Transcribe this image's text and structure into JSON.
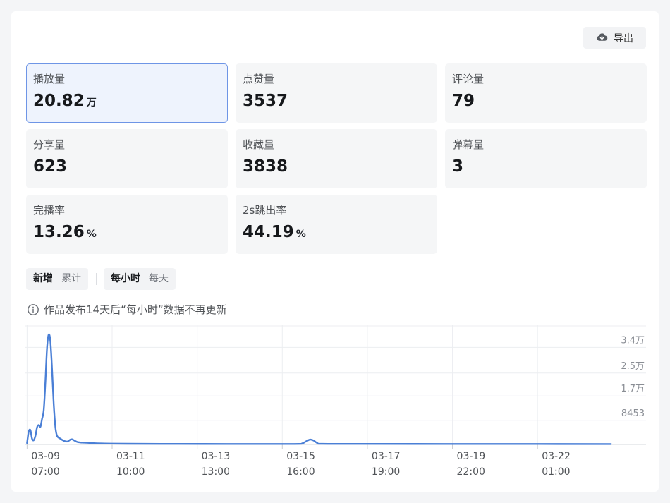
{
  "toolbar": {
    "export_label": "导出",
    "export_icon": "cloud-download-icon"
  },
  "metrics": [
    {
      "label": "播放量",
      "value": "20.82",
      "unit": "万",
      "active": true
    },
    {
      "label": "点赞量",
      "value": "3537",
      "unit": ""
    },
    {
      "label": "评论量",
      "value": "79",
      "unit": ""
    },
    {
      "label": "分享量",
      "value": "623",
      "unit": ""
    },
    {
      "label": "收藏量",
      "value": "3838",
      "unit": ""
    },
    {
      "label": "弹幕量",
      "value": "3",
      "unit": ""
    },
    {
      "label": "完播率",
      "value": "13.26",
      "unit": "%"
    },
    {
      "label": "2s跳出率",
      "value": "44.19",
      "unit": "%"
    }
  ],
  "toggles": {
    "mode": {
      "options": [
        "新增",
        "累计"
      ],
      "selected": "新增"
    },
    "granularity": {
      "options": [
        "每小时",
        "每天"
      ],
      "selected": "每小时"
    }
  },
  "notice": {
    "icon": "info-circle-icon",
    "text": "作品发布14天后“每小时”数据不再更新"
  },
  "colors": {
    "accent": "#4a7fd6",
    "active_border": "#6e95e6",
    "active_bg": "#eef3fd"
  },
  "chart_data": {
    "type": "line",
    "grid": true,
    "ylim": [
      0,
      42000
    ],
    "y_ticks": [
      {
        "value": 8453,
        "label": "8453"
      },
      {
        "value": 17000,
        "label": "1.7万"
      },
      {
        "value": 25000,
        "label": "2.5万"
      },
      {
        "value": 34000,
        "label": "3.4万"
      }
    ],
    "x_ticks": [
      {
        "hour": 0,
        "date": "03-09",
        "time": "07:00"
      },
      {
        "hour": 51,
        "date": "03-11",
        "time": "10:00"
      },
      {
        "hour": 102,
        "date": "03-13",
        "time": "13:00"
      },
      {
        "hour": 153,
        "date": "03-15",
        "time": "16:00"
      },
      {
        "hour": 204,
        "date": "03-17",
        "time": "19:00"
      },
      {
        "hour": 255,
        "date": "03-19",
        "time": "22:00"
      },
      {
        "hour": 306,
        "date": "03-22",
        "time": "01:00"
      }
    ],
    "xlim": [
      -1,
      352
    ],
    "series": [
      {
        "points": [
          [
            0,
            500
          ],
          [
            1,
            4500
          ],
          [
            2,
            5000
          ],
          [
            3,
            2000
          ],
          [
            4,
            1500
          ],
          [
            5,
            3000
          ],
          [
            6,
            6000
          ],
          [
            7,
            6800
          ],
          [
            8,
            6200
          ],
          [
            9,
            9000
          ],
          [
            10,
            12000
          ],
          [
            11,
            22000
          ],
          [
            12,
            34000
          ],
          [
            13,
            38500
          ],
          [
            14,
            36000
          ],
          [
            15,
            26000
          ],
          [
            16,
            14000
          ],
          [
            17,
            6000
          ],
          [
            18,
            3000
          ],
          [
            20,
            2000
          ],
          [
            22,
            1300
          ],
          [
            24,
            1000
          ],
          [
            25,
            1300
          ],
          [
            26,
            1700
          ],
          [
            27,
            1800
          ],
          [
            28,
            1500
          ],
          [
            30,
            900
          ],
          [
            32,
            700
          ],
          [
            34,
            650
          ],
          [
            36,
            600
          ],
          [
            40,
            450
          ],
          [
            45,
            350
          ],
          [
            50,
            300
          ],
          [
            60,
            250
          ],
          [
            80,
            200
          ],
          [
            120,
            180
          ],
          [
            160,
            180
          ],
          [
            165,
            400
          ],
          [
            167,
            1000
          ],
          [
            169,
            1600
          ],
          [
            170,
            1700
          ],
          [
            172,
            1300
          ],
          [
            174,
            500
          ],
          [
            177,
            220
          ],
          [
            200,
            200
          ],
          [
            250,
            180
          ],
          [
            300,
            160
          ],
          [
            350,
            150
          ]
        ]
      }
    ]
  }
}
